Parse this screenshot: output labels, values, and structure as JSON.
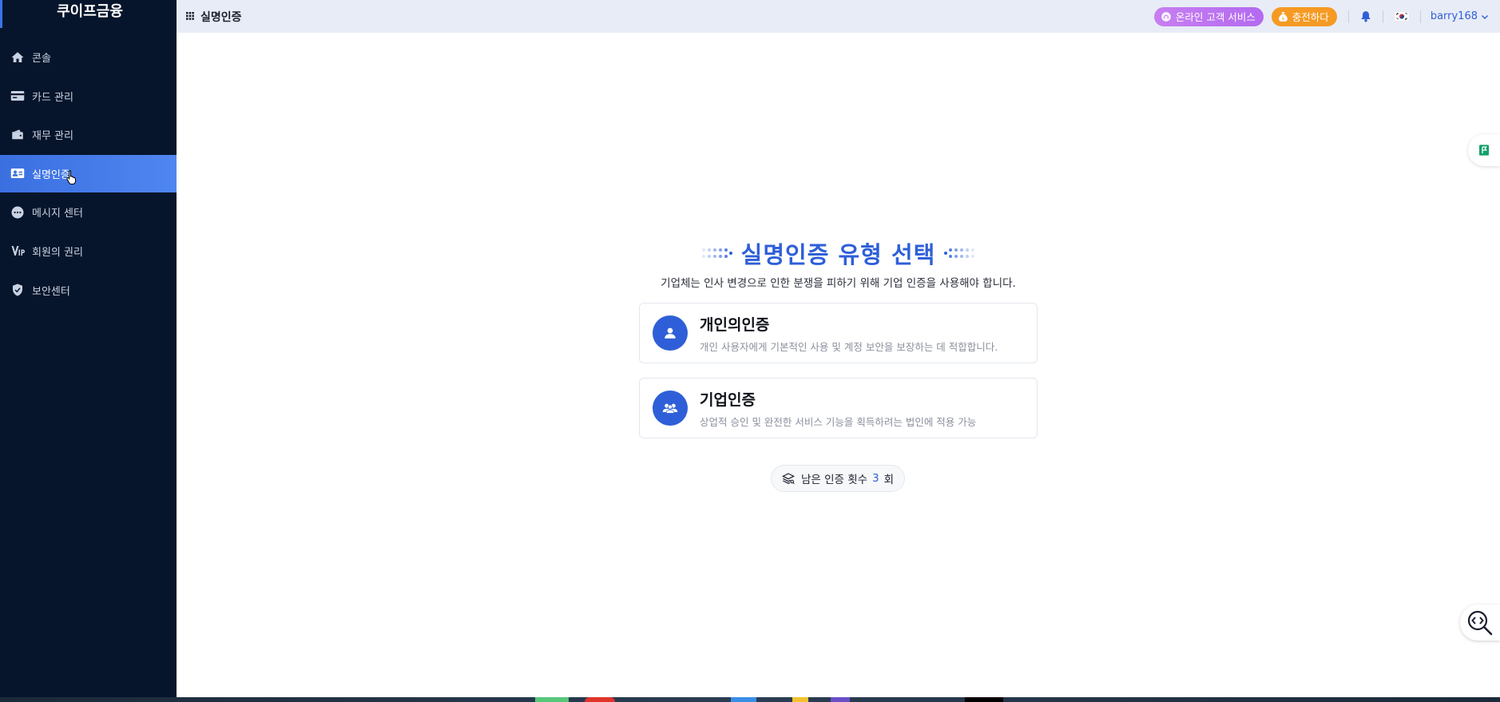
{
  "sidebar": {
    "brand": "쿠이프금융",
    "items": [
      {
        "label": "콘솔",
        "icon": "home-icon"
      },
      {
        "label": "카드 관리",
        "icon": "card-icon"
      },
      {
        "label": "재무 관리",
        "icon": "wallet-icon"
      },
      {
        "label": "실명인증",
        "icon": "id-card-icon",
        "active": true
      },
      {
        "label": "메시지 센터",
        "icon": "chat-icon"
      },
      {
        "label": "회원의 권리",
        "icon": "vip-icon"
      },
      {
        "label": "보안센터",
        "icon": "shield-icon"
      }
    ]
  },
  "topbar": {
    "page_title": "실명인증",
    "customer_service": "온라인 고객 서비스",
    "charge": "충전하다",
    "username": "barry168"
  },
  "main": {
    "heading": "실명인증 유형 선택",
    "subtitle": "기업체는 인사 변경으로 인한 분쟁을 피하기 위해 기업 인증을 사용해야 합니다.",
    "cards": [
      {
        "title": "개인의인증",
        "desc": "개인 사용자에게 기본적인 사용 및 계정 보안을 보장하는 데 적합합니다."
      },
      {
        "title": "기업인증",
        "desc": "상업적 승인 및 완전한 서비스 기능을 획득하려는 법인에 적용 가능"
      }
    ],
    "remaining": {
      "prefix": "남은 인증 횟수",
      "count": "3",
      "suffix": "회"
    }
  },
  "colors": {
    "sidebar_bg": "#06152b",
    "accent": "#2f5fd8",
    "active_nav": "#3a6fe0",
    "cs_pill": "#c77ff0",
    "charge_pill": "#f59a23"
  }
}
